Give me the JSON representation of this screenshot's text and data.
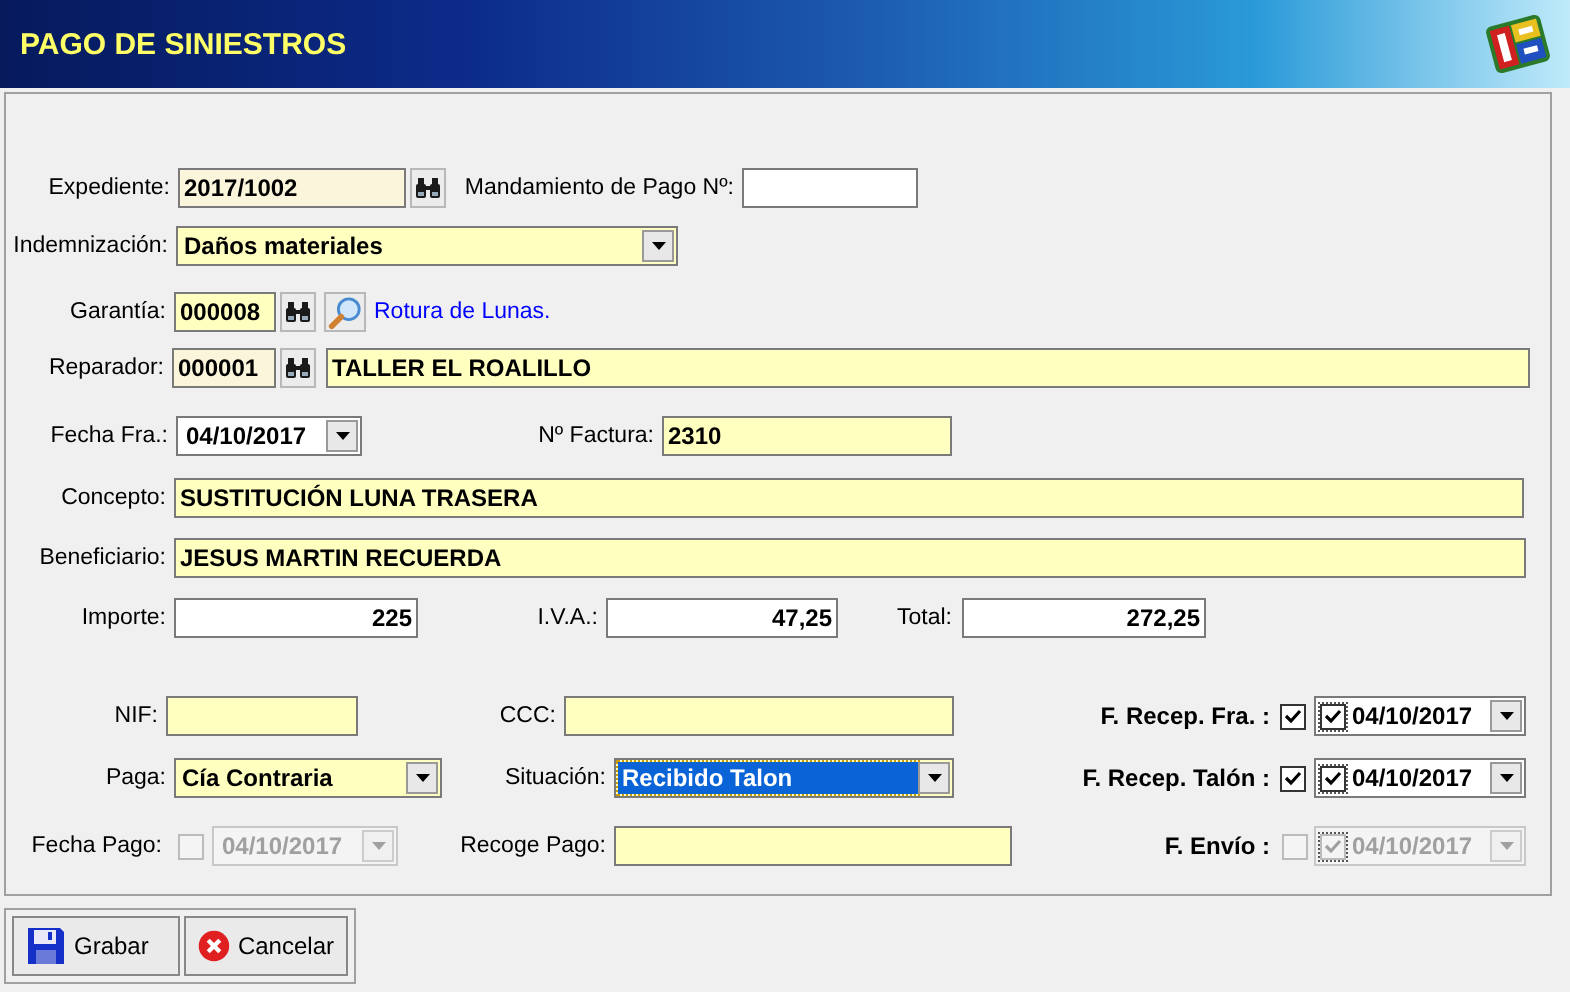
{
  "window": {
    "title": "PAGO DE SINIESTROS"
  },
  "expediente": {
    "label": "Expediente:",
    "value": "2017/1002"
  },
  "mandamiento": {
    "label": "Mandamiento de Pago Nº:"
  },
  "indemnizacion": {
    "label": "Indemnización:",
    "value": "Daños materiales"
  },
  "garantia": {
    "label": "Garantía:",
    "value": "000008",
    "link": "Rotura de Lunas."
  },
  "reparador": {
    "label": "Reparador:",
    "code": "000001",
    "name": "TALLER EL ROALILLO"
  },
  "fecha_fra": {
    "label": "Fecha Fra.:",
    "value": "04/10/2017"
  },
  "factura": {
    "label": "Nº Factura:",
    "value": "2310"
  },
  "concepto": {
    "label": "Concepto:",
    "value": "SUSTITUCIÓN LUNA TRASERA"
  },
  "beneficiario": {
    "label": "Beneficiario:",
    "value": "JESUS MARTIN RECUERDA"
  },
  "importe": {
    "label": "Importe:",
    "value": "225"
  },
  "iva": {
    "label": "I.V.A.:",
    "value": "47,25"
  },
  "total": {
    "label": "Total:",
    "value": "272,25"
  },
  "nif": {
    "label": "NIF:"
  },
  "ccc": {
    "label": "CCC:"
  },
  "paga": {
    "label": "Paga:",
    "value": "Cía Contraria"
  },
  "situacion": {
    "label": "Situación:",
    "value": "Recibido Talon",
    "selected": true
  },
  "fecha_pago": {
    "label": "Fecha Pago:",
    "checked": false,
    "value": "04/10/2017",
    "disabled": true
  },
  "recoge_pago": {
    "label": "Recoge Pago:"
  },
  "dates": [
    {
      "label": "F. Recep. Fra. :",
      "checked": true,
      "inner_checked": true,
      "value": "04/10/2017",
      "disabled": false
    },
    {
      "label": "F. Recep. Talón :",
      "checked": true,
      "inner_checked": true,
      "value": "04/10/2017",
      "disabled": false
    },
    {
      "label": "F. Envío :",
      "checked": false,
      "inner_checked": true,
      "value": "04/10/2017",
      "disabled": true
    }
  ],
  "buttons": [
    {
      "label": "Grabar",
      "kind": "save"
    },
    {
      "label": "Cancelar",
      "kind": "cancel"
    }
  ]
}
